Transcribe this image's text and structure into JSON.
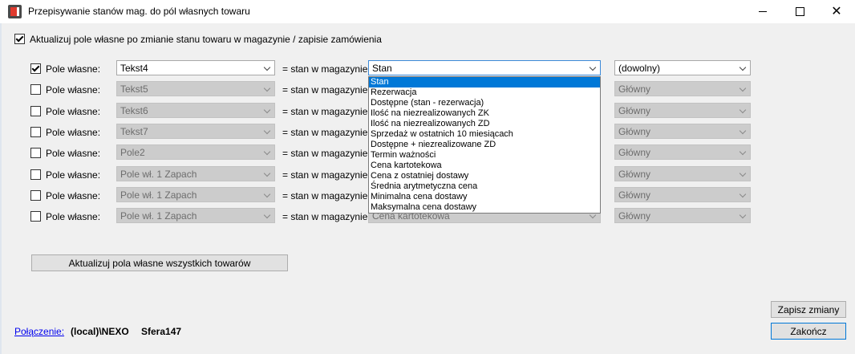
{
  "window": {
    "title": "Przepisywanie stanów mag. do pól własnych towaru",
    "close_glyph": "✕"
  },
  "auto_update": {
    "label": "Aktualizuj pole własne po zmianie stanu towaru w magazynie / zapisie zamówienia",
    "checked": true
  },
  "rows": [
    {
      "checked": true,
      "label": "Pole własne:",
      "field": "Tekst4",
      "eq_label": "= stan w magazynie:",
      "stock": "Stan",
      "warehouse": "(dowolny)",
      "enabled": true
    },
    {
      "checked": false,
      "label": "Pole własne:",
      "field": "Tekst5",
      "eq_label": "= stan w magazynie:",
      "stock": "",
      "warehouse": "Główny",
      "enabled": false
    },
    {
      "checked": false,
      "label": "Pole własne:",
      "field": "Tekst6",
      "eq_label": "= stan w magazynie:",
      "stock": "",
      "warehouse": "Główny",
      "enabled": false
    },
    {
      "checked": false,
      "label": "Pole własne:",
      "field": "Tekst7",
      "eq_label": "= stan w magazynie:",
      "stock": "",
      "warehouse": "Główny",
      "enabled": false
    },
    {
      "checked": false,
      "label": "Pole własne:",
      "field": "Pole2",
      "eq_label": "= stan w magazynie:",
      "stock": "",
      "warehouse": "Główny",
      "enabled": false
    },
    {
      "checked": false,
      "label": "Pole własne:",
      "field": "Pole wł. 1 Zapach",
      "eq_label": "= stan w magazynie:",
      "stock": "",
      "warehouse": "Główny",
      "enabled": false
    },
    {
      "checked": false,
      "label": "Pole własne:",
      "field": "Pole wł. 1 Zapach",
      "eq_label": "= stan w magazynie:",
      "stock": "",
      "warehouse": "Główny",
      "enabled": false
    },
    {
      "checked": false,
      "label": "Pole własne:",
      "field": "Pole wł. 1 Zapach",
      "eq_label": "= stan w magazynie:",
      "stock": "Cena kartotekowa",
      "warehouse": "Główny",
      "enabled": false
    }
  ],
  "dropdown": {
    "selected_index": 0,
    "options": [
      "Stan",
      "Rezerwacja",
      "Dostępne (stan - rezerwacja)",
      "Ilość na niezrealizowanych ZK",
      "Ilość na niezrealizowanych ZD",
      "Sprzedaż w ostatnich 10 miesiącach",
      "Dostępne + niezrealizowane ZD",
      "Termin ważności",
      "Cena kartotekowa",
      "Cena z ostatniej dostawy",
      "Średnia arytmetyczna cena",
      "Minimalna cena dostawy",
      "Maksymalna cena dostawy"
    ]
  },
  "buttons": {
    "update_all": "Aktualizuj pola własne wszystkich towarów",
    "save": "Zapisz zmiany",
    "close": "Zakończ"
  },
  "connection": {
    "link_label": "Połączenie:",
    "server": "(local)\\NEXO",
    "database": "Sfera147"
  }
}
